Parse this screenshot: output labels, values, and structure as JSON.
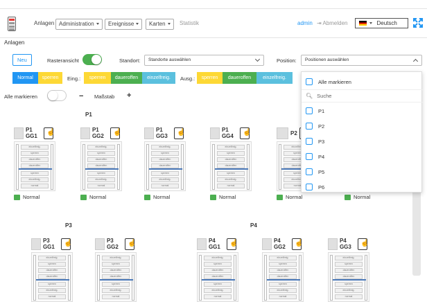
{
  "header": {
    "menu": [
      "Anlagen",
      "Administration",
      "Ereignisse",
      "Karten",
      "Statistik"
    ],
    "user": "admin",
    "logout": "Abmelden",
    "language": "Deutsch"
  },
  "breadcrumb": "Anlagen",
  "toolbar": {
    "new_label": "Neu",
    "grid_label": "Rasteransicht",
    "location_label": "Standort:",
    "location_placeholder": "Standorte auswählen",
    "position_label": "Position:",
    "position_placeholder": "Positionen auswählen"
  },
  "modes": {
    "main": [
      "Normal",
      "sperren"
    ],
    "eing_label": "Eing.:",
    "eing": [
      "sperren",
      "daueroffen",
      "einzelfreig."
    ],
    "ausg_label": "Ausg.:",
    "ausg": [
      "sperren",
      "daueroffen",
      "einzelfreig."
    ]
  },
  "controls": {
    "mark_all": "Alle markieren",
    "minus": "−",
    "scale": "Maßstab",
    "plus": "+"
  },
  "groups": [
    {
      "title": "P1",
      "cards": [
        {
          "name": "P1 GG1",
          "status": "Normal"
        },
        {
          "name": "P1 GG2",
          "status": "Normal"
        },
        {
          "name": "P1 GG3",
          "status": "Normal"
        },
        {
          "name": "P1 GG4",
          "status": "Normal"
        },
        {
          "name": "P2",
          "status": "Normal"
        },
        {
          "name": "",
          "status": "Normal"
        }
      ]
    },
    {
      "title": "P3",
      "cards": [
        {
          "name": "P3 GG1"
        },
        {
          "name": "P3 GG2"
        }
      ]
    },
    {
      "title": "P4",
      "cards": [
        {
          "name": "P4 GG1"
        },
        {
          "name": "P4 GG2"
        },
        {
          "name": "P4 GG3"
        }
      ]
    }
  ],
  "door_labels": [
    "einzelfreig.",
    "sperren",
    "daueroffen",
    "daueroffen",
    "sperren",
    "einzelfreig.",
    "normal",
    "sperren"
  ],
  "dropdown": {
    "mark_all": "Alle markieren",
    "search_placeholder": "Suche",
    "options": [
      "P1",
      "P2",
      "P3",
      "P4",
      "P5",
      "P6"
    ]
  },
  "colors": {
    "primary": "#2196f3",
    "sperren": "#fdd835",
    "daueroffen": "#4caf50",
    "einzelfreig": "#5bc0de",
    "toggle_on": "#4caf50"
  }
}
